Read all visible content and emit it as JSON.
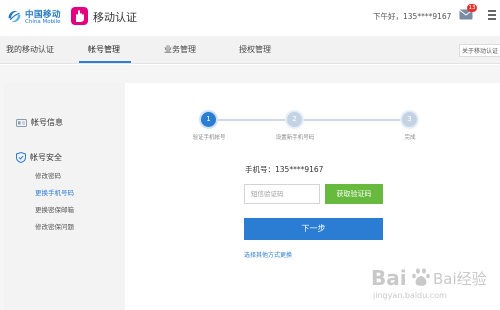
{
  "header": {
    "logo_cn": "中国移动",
    "logo_en": "China Mobile",
    "app_title": "移动认证",
    "greeting": "下午好，135****9167",
    "mail_badge": "13",
    "icons": [
      "china-mobile-logo",
      "app-badge-icon",
      "mail-icon",
      "menu-icon"
    ]
  },
  "nav": {
    "items": [
      {
        "label": "我的移动认证",
        "active": false
      },
      {
        "label": "帐号管理",
        "active": true
      },
      {
        "label": "业务管理",
        "active": false
      },
      {
        "label": "授权管理",
        "active": false
      }
    ],
    "about": "关于移动认证"
  },
  "sidebar": {
    "groups": [
      {
        "label": "帐号信息",
        "icon": "id-card-icon",
        "items": []
      },
      {
        "label": "帐号安全",
        "icon": "shield-check-icon",
        "items": [
          {
            "label": "修改密码",
            "active": false
          },
          {
            "label": "更换手机号码",
            "active": true
          },
          {
            "label": "更换密保邮箱",
            "active": false
          },
          {
            "label": "修改密保问题",
            "active": false
          }
        ]
      }
    ]
  },
  "stepper": {
    "steps": [
      {
        "number": "1",
        "label": "验证手机帐号",
        "state": "current"
      },
      {
        "number": "2",
        "label": "设置新手机号码",
        "state": "pending"
      },
      {
        "number": "3",
        "label": "完成",
        "state": "pending"
      }
    ]
  },
  "form": {
    "phone_label": "手机号：135****9167",
    "code_placeholder": "短信验证码",
    "get_code_label": "获取验证码",
    "next_label": "下一步",
    "alt_link": "选择其他方式更换"
  },
  "watermark": {
    "text": "Bai经验",
    "url": "jingyan.baidu.com"
  },
  "colors": {
    "accent": "#2b7cd3",
    "green": "#67ba3e",
    "magenta": "#e4007f",
    "badge_red": "#e5322d"
  }
}
